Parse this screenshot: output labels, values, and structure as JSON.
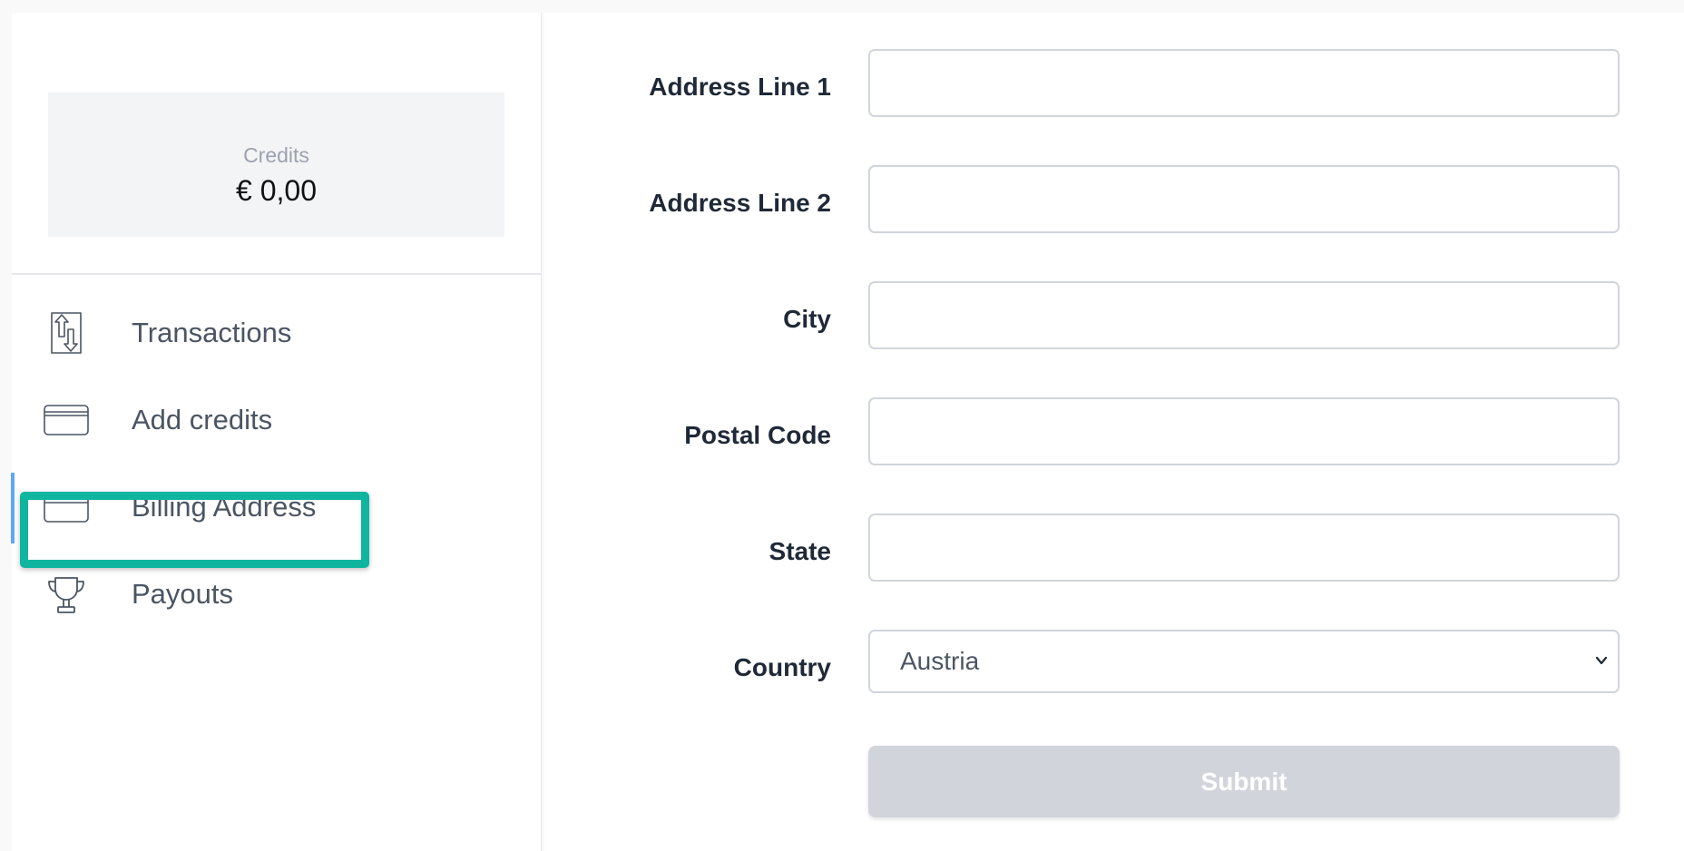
{
  "sidebar": {
    "credits": {
      "label": "Credits",
      "value": "€ 0,00"
    },
    "items": [
      {
        "label": "Transactions",
        "icon": "transactions-icon"
      },
      {
        "label": "Add credits",
        "icon": "credit-card-icon"
      },
      {
        "label": "Billing Address",
        "icon": "credit-card-icon"
      },
      {
        "label": "Payouts",
        "icon": "trophy-icon"
      }
    ],
    "active_item": "Billing Address",
    "highlight_color": "#10b5a0"
  },
  "form": {
    "fields": [
      {
        "label": "Address Line 1",
        "value": ""
      },
      {
        "label": "Address Line 2",
        "value": ""
      },
      {
        "label": "City",
        "value": ""
      },
      {
        "label": "Postal Code",
        "value": ""
      },
      {
        "label": "State",
        "value": ""
      }
    ],
    "country": {
      "label": "Country",
      "value": "Austria"
    },
    "submit_label": "Submit"
  }
}
